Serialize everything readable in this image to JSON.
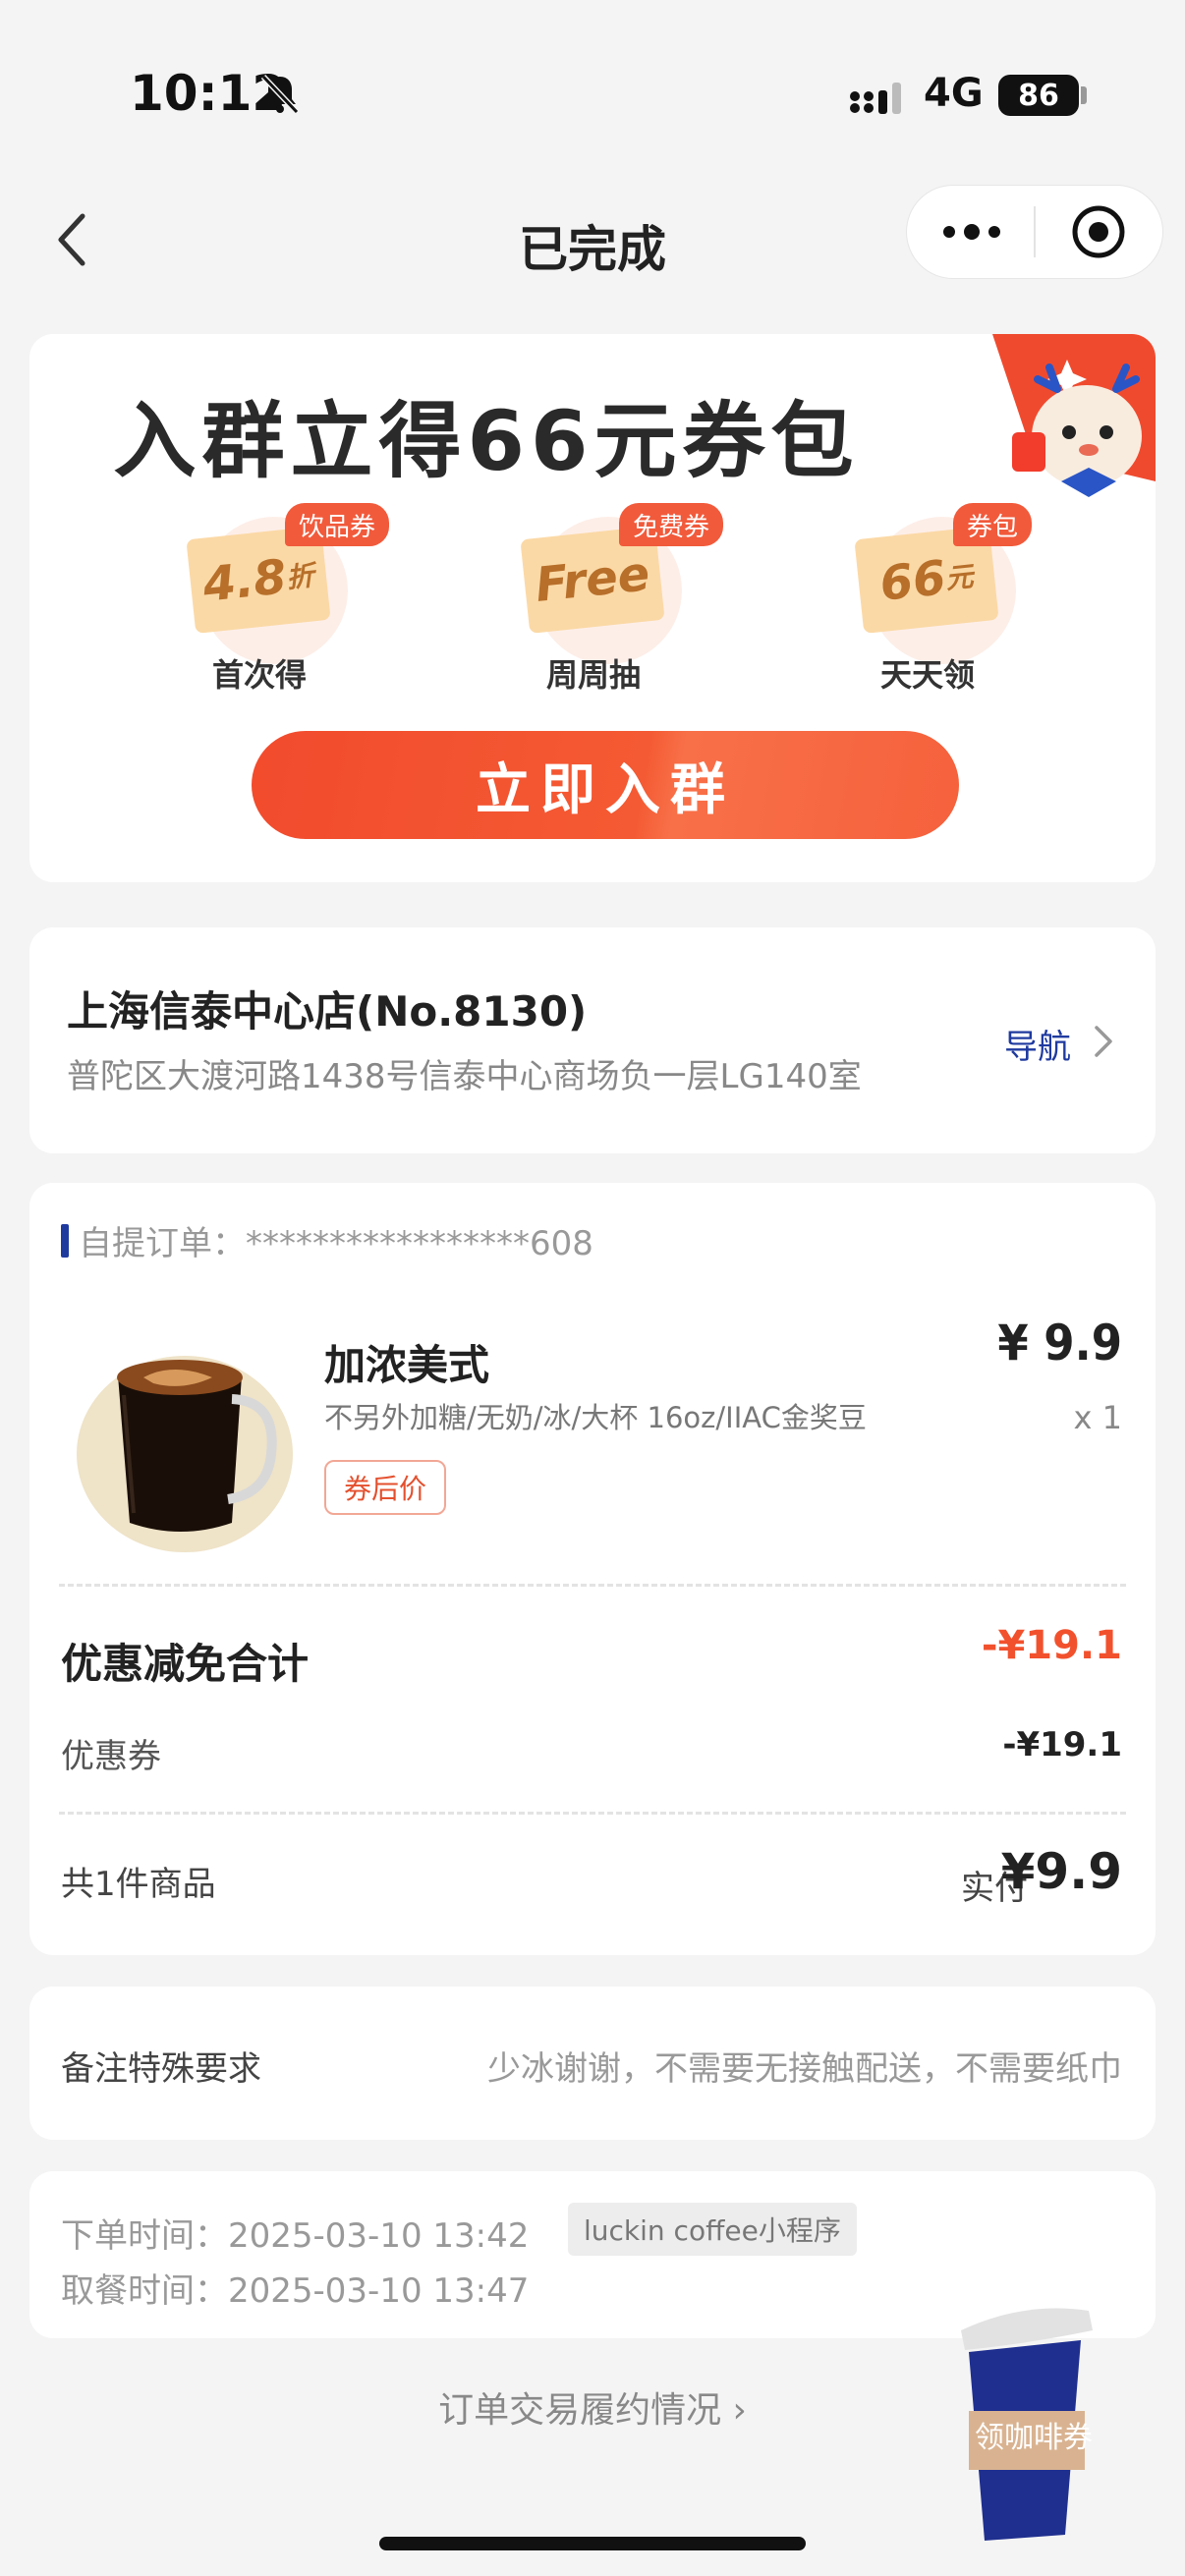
{
  "status_bar": {
    "time": "10:12",
    "network": "4G",
    "battery": "86"
  },
  "nav": {
    "title": "已完成"
  },
  "promo": {
    "title": "入群立得66元券包",
    "coupons": [
      {
        "tag": "饮品券",
        "ticket_main": "4.8",
        "ticket_sub": "折",
        "caption": "首次得"
      },
      {
        "tag": "免费券",
        "ticket_main": "Free",
        "ticket_sub": "",
        "caption": "周周抽"
      },
      {
        "tag": "券包",
        "ticket_main": "66",
        "ticket_sub": "元",
        "caption": "天天领"
      }
    ],
    "button_label": "立即入群"
  },
  "store": {
    "name": "上海信泰中心店(No.8130)",
    "address": "普陀区大渡河路1438号信泰中心商场负一层LG140室",
    "nav_label": "导航"
  },
  "order": {
    "label": "自提订单：*****************608",
    "product": {
      "name": "加浓美式",
      "spec": "不另外加糖/无奶/冰/大杯 16oz/IIAC金奖豆",
      "badge": "券后价",
      "price": "¥ 9.9",
      "qty": "x 1"
    },
    "discount_title": "优惠减免合计",
    "discount_total": "-¥19.1",
    "coupon_label": "优惠券",
    "coupon_value": "-¥19.1",
    "items_count": "共1件商品",
    "paid_label": "实付",
    "paid_value": "¥9.9"
  },
  "remark": {
    "label": "备注特殊要求",
    "value": "少冰谢谢，不需要无接触配送，不需要纸巾"
  },
  "times": {
    "order_time": "下单时间：2025-03-10 13:42",
    "pickup_time": "取餐时间：2025-03-10 13:47",
    "source": "luckin coffee小程序"
  },
  "footer": {
    "link": "订单交易履约情况 ›",
    "cup_label": "领咖啡券"
  },
  "colors": {
    "accent": "#f24b2d",
    "brand_blue": "#1f3a9f",
    "background": "#f4f4f4"
  }
}
